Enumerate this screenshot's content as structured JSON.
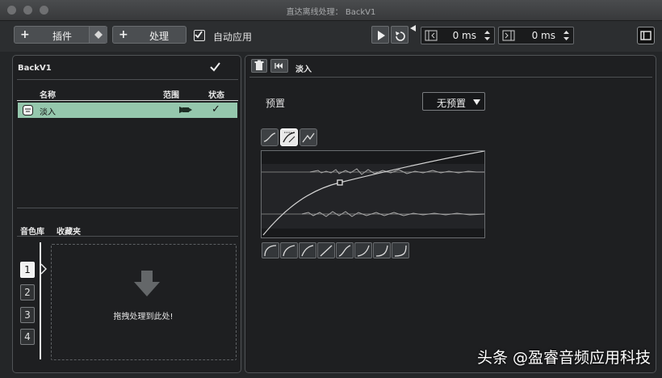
{
  "window": {
    "title": "直达离线处理： BackV1"
  },
  "toolbar": {
    "plugin_label": "插件",
    "process_label": "处理",
    "auto_apply_label": "自动应用",
    "auto_apply_checked": true,
    "pre_time": "0 ms",
    "post_time": "0 ms"
  },
  "left_panel": {
    "clip_name": "BackV1",
    "columns": {
      "name": "名称",
      "range": "范围",
      "status": "状态"
    },
    "rows": [
      {
        "name": "淡入",
        "status": "✓"
      }
    ],
    "library_tabs": [
      "音色库",
      "收藏夹"
    ],
    "slots": [
      "1",
      "2",
      "3",
      "4"
    ],
    "active_slot": "1",
    "drop_hint": "拖拽处理到此处!"
  },
  "right_panel": {
    "process_name": "淡入",
    "preset_label": "预置",
    "preset_value": "无预置"
  },
  "watermark": "头条 @盈睿音频应用科技"
}
